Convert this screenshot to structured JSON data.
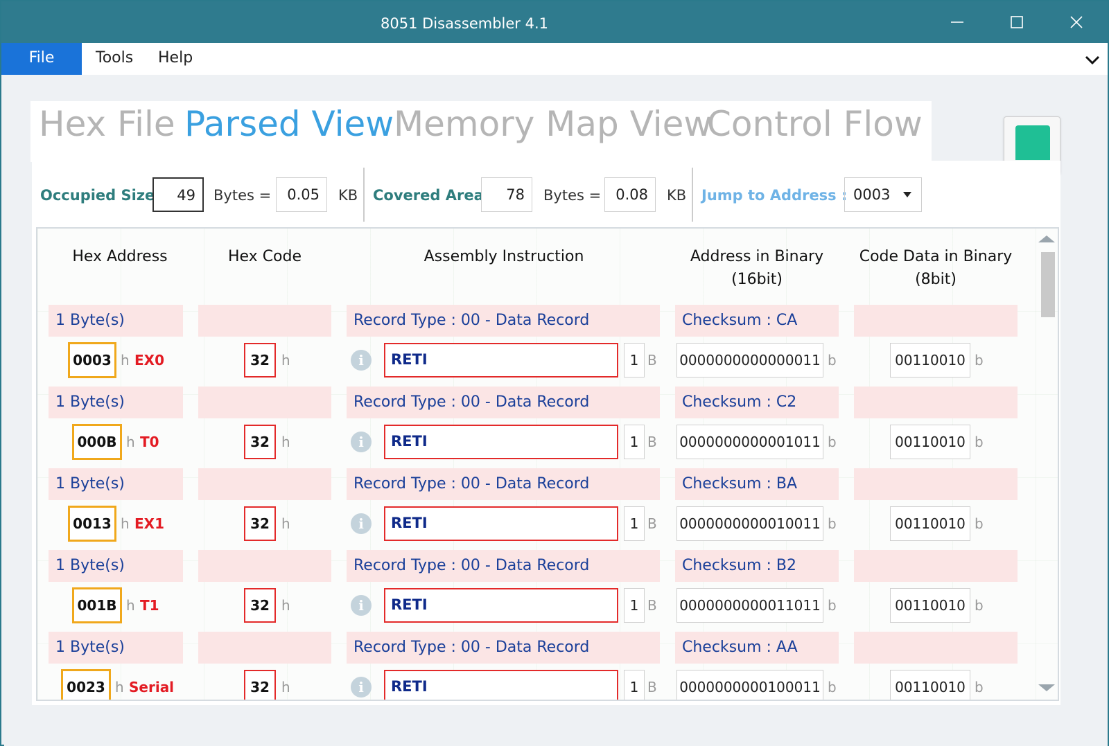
{
  "window": {
    "title": "8051 Disassembler 4.1",
    "minimize_label": "—",
    "maximize_label": "☐",
    "close_label": "✕"
  },
  "menu": {
    "file": "File",
    "tools": "Tools",
    "help": "Help"
  },
  "tabs": {
    "hex_file": "Hex File",
    "parsed_view": "Parsed View",
    "memory_map_view": "Memory Map View",
    "control_flow": "Control Flow"
  },
  "stats": {
    "occupied_label": "Occupied Size",
    "occupied_bytes": "49",
    "occupied_kb": "0.05",
    "covered_label": "Covered Area",
    "covered_bytes": "78",
    "covered_kb": "0.08",
    "bytes_eq": "Bytes =",
    "kb": "KB",
    "jump_label": "Jump to Address :",
    "jump_value": "0003"
  },
  "columns": {
    "hex_address": "Hex Address",
    "hex_code": "Hex Code",
    "assembly_instruction": "Assembly Instruction",
    "address_binary_1": "Address in Binary",
    "address_binary_2": "(16bit)",
    "code_binary_1": "Code Data in Binary",
    "code_binary_2": "(8bit)"
  },
  "suffixes": {
    "h": "h",
    "b": "b",
    "B": "B",
    "info": "i"
  },
  "rows": [
    {
      "size": "1 Byte(s)",
      "record": "Record Type : 00 - Data Record",
      "checksum": "Checksum : CA",
      "address": "0003",
      "vector": "EX0",
      "code": "32",
      "instruction": "RETI",
      "length": "1",
      "addr_bin": "0000000000000011",
      "code_bin": "00110010"
    },
    {
      "size": "1 Byte(s)",
      "record": "Record Type : 00 - Data Record",
      "checksum": "Checksum : C2",
      "address": "000B",
      "vector": "T0",
      "code": "32",
      "instruction": "RETI",
      "length": "1",
      "addr_bin": "0000000000001011",
      "code_bin": "00110010"
    },
    {
      "size": "1 Byte(s)",
      "record": "Record Type : 00 - Data Record",
      "checksum": "Checksum : BA",
      "address": "0013",
      "vector": "EX1",
      "code": "32",
      "instruction": "RETI",
      "length": "1",
      "addr_bin": "0000000000010011",
      "code_bin": "00110010"
    },
    {
      "size": "1 Byte(s)",
      "record": "Record Type : 00 - Data Record",
      "checksum": "Checksum : B2",
      "address": "001B",
      "vector": "T1",
      "code": "32",
      "instruction": "RETI",
      "length": "1",
      "addr_bin": "0000000000011011",
      "code_bin": "00110010"
    },
    {
      "size": "1 Byte(s)",
      "record": "Record Type : 00 - Data Record",
      "checksum": "Checksum : AA",
      "address": "0023",
      "vector": "Serial",
      "code": "32",
      "instruction": "RETI",
      "length": "1",
      "addr_bin": "0000000000100011",
      "code_bin": "00110010"
    }
  ],
  "colors": {
    "titlebar": "#2f7b8e",
    "accent_blue": "#1a73d9",
    "active_tab": "#3aa0e0",
    "occupied_label": "#2e7d7d",
    "jump_label": "#6fb3e6",
    "record_bg": "#fbe5e5",
    "record_text": "#1a3f99",
    "address_border": "#f0a81c",
    "vector_text": "#e31b23",
    "instruction_text": "#0f2a8a"
  },
  "icons": {
    "book": "book-icon",
    "info": "info-icon",
    "chevron": "chevron-down-icon"
  }
}
